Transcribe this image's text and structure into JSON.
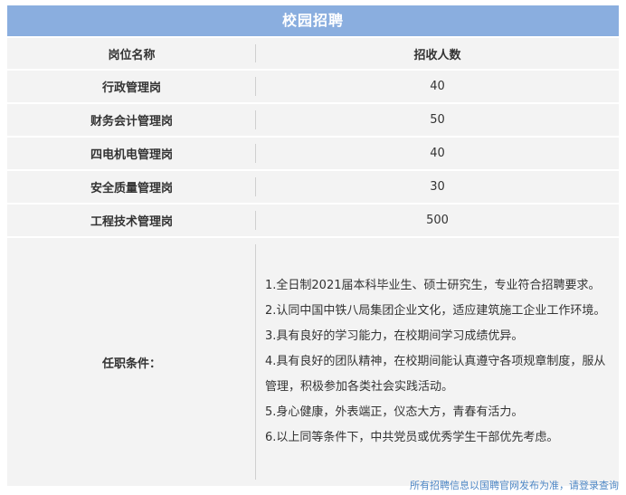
{
  "table": {
    "title": "校园招聘",
    "headers": {
      "position": "岗位名称",
      "count": "招收人数"
    },
    "rows": [
      {
        "position": "行政管理岗",
        "count": "40"
      },
      {
        "position": "财务会计管理岗",
        "count": "50"
      },
      {
        "position": "四电机电管理岗",
        "count": "40"
      },
      {
        "position": "安全质量管理岗",
        "count": "30"
      },
      {
        "position": "工程技术管理岗",
        "count": "500"
      }
    ],
    "requirements": {
      "label": "任职条件：",
      "items": [
        "1.全日制2021届本科毕业生、硕士研究生，专业符合招聘要求。",
        "2.认同中国中铁八局集团企业文化，适应建筑施工企业工作环境。",
        "3.具有良好的学习能力，在校期间学习成绩优异。",
        "4.具有良好的团队精神，在校期间能认真遵守各项规章制度，服从管理，积极参加各类社会实践活动。",
        "5.身心健康，外表端正，仪态大方，青春有活力。",
        "6.以上同等条件下，中共党员或优秀学生干部优先考虑。"
      ]
    }
  },
  "footer": {
    "note": "所有招聘信息以国聘官网发布为准，请登录查询"
  },
  "colors": {
    "title_bg": "#8aaedf",
    "cell_bg": "#f3f3f3",
    "link": "#4f88c6"
  }
}
